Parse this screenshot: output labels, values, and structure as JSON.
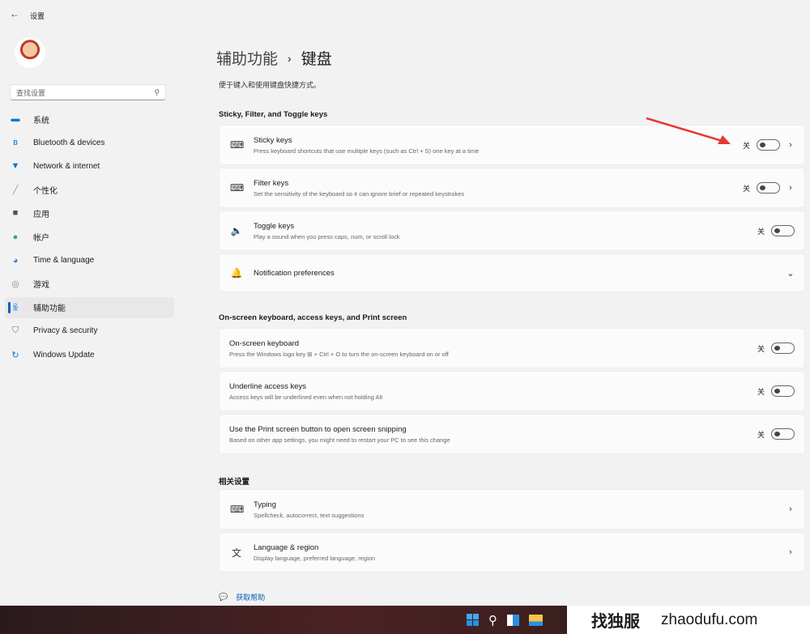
{
  "window": {
    "title": "设置",
    "back_icon": "arrow-left-icon"
  },
  "search": {
    "placeholder": "查找设置"
  },
  "sidebar": {
    "items": [
      {
        "label": "系统",
        "icon": "monitor-icon",
        "color": "#0078d4"
      },
      {
        "label": "Bluetooth & devices",
        "icon": "bluetooth-icon",
        "color": "#0078d4"
      },
      {
        "label": "Network & internet",
        "icon": "wifi-icon",
        "color": "#0078d4"
      },
      {
        "label": "个性化",
        "icon": "brush-icon",
        "color": "#e08a3c"
      },
      {
        "label": "应用",
        "icon": "apps-icon",
        "color": "#44546a"
      },
      {
        "label": "帐户",
        "icon": "person-icon",
        "color": "#2aa889"
      },
      {
        "label": "Time & language",
        "icon": "globe-clock-icon",
        "color": "#2b88d8"
      },
      {
        "label": "游戏",
        "icon": "gamepad-icon",
        "color": "#888888"
      },
      {
        "label": "辅助功能",
        "icon": "accessibility-icon",
        "color": "#0078d4",
        "active": true
      },
      {
        "label": "Privacy & security",
        "icon": "shield-icon",
        "color": "#777777"
      },
      {
        "label": "Windows Update",
        "icon": "update-icon",
        "color": "#0078d4"
      }
    ]
  },
  "breadcrumb": {
    "parent": "辅助功能",
    "sep": "›",
    "current": "键盘"
  },
  "description": "便于键入和使用键盘快捷方式。",
  "sections": [
    {
      "title": "Sticky, Filter, and Toggle keys"
    },
    {
      "title": "On-screen keyboard, access keys, and Print screen"
    },
    {
      "title": "相关设置"
    }
  ],
  "settings": [
    {
      "title": "Sticky keys",
      "sub": "Press keyboard shortcuts that use multiple keys (such as Ctrl + S) one key at a time",
      "state": "关",
      "on": false,
      "chevron": true
    },
    {
      "title": "Filter keys",
      "sub": "Set the sensitivity of the keyboard so it can ignore brief or repeated keystrokes",
      "state": "关",
      "on": false,
      "chevron": true
    },
    {
      "title": "Toggle keys",
      "sub": "Play a sound when you press caps, num, or scroll lock",
      "state": "关",
      "on": false
    },
    {
      "title": "Notification preferences"
    },
    {
      "title": "On-screen keyboard",
      "sub": "Press the Windows logo key ⊞ + Ctrl + O to turn the on-screen keyboard on or off",
      "state": "关",
      "on": false
    },
    {
      "title": "Underline access keys",
      "sub": "Access keys will be underlined even when not holding Alt",
      "state": "关",
      "on": false
    },
    {
      "title": "Use the Print screen button to open screen snipping",
      "sub": "Based on other app settings, you might need to restart your PC to see this change",
      "state": "关",
      "on": false
    },
    {
      "title": "Typing",
      "sub": "Spellcheck, autocorrect, text suggestions"
    },
    {
      "title": "Language & region",
      "sub": "Display language, preferred language, region"
    }
  ],
  "help": {
    "label": "获取帮助"
  },
  "watermark": {
    "cn": "找独服",
    "en": "zhaodufu.com"
  },
  "annotation": {
    "color": "#e53935"
  }
}
